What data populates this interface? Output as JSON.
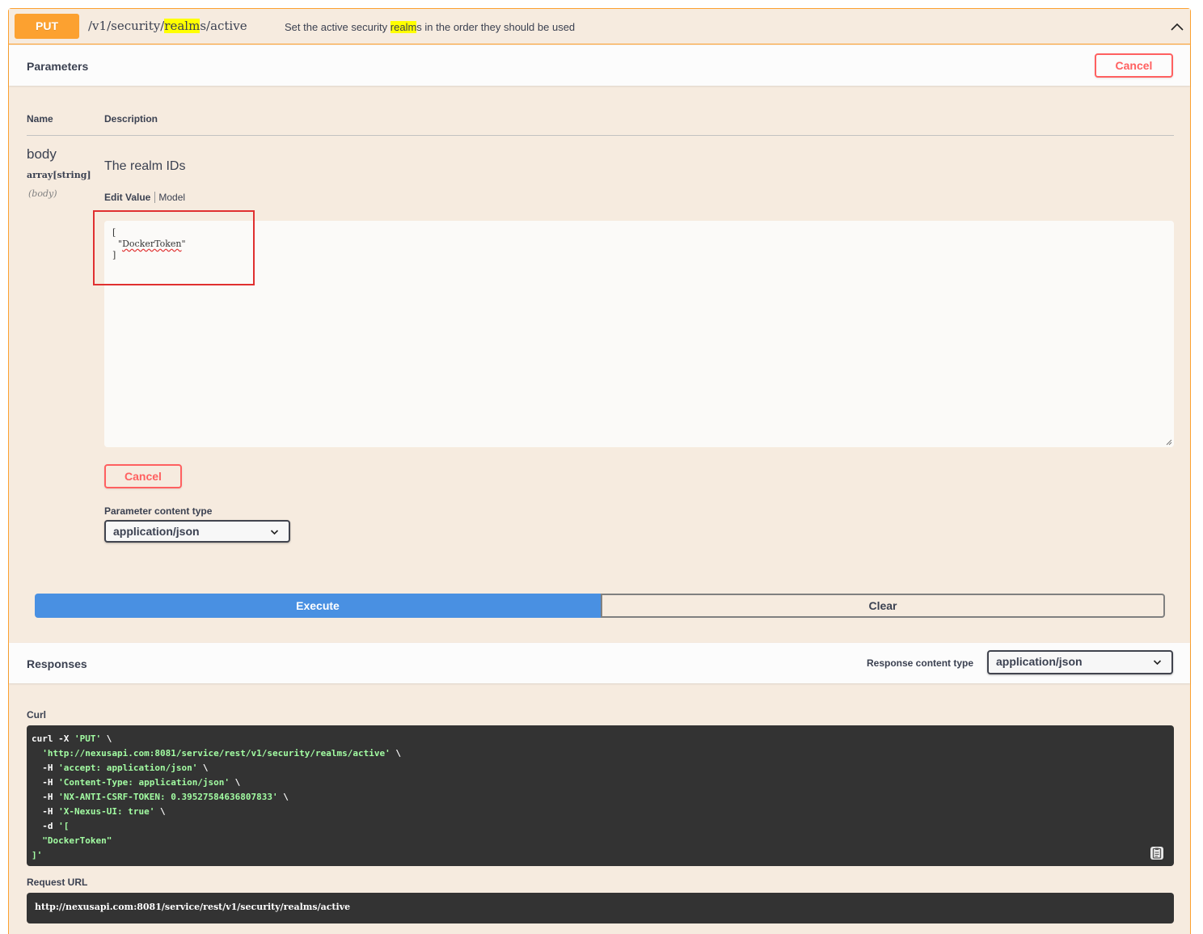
{
  "summary": {
    "method": "PUT",
    "path_prefix": "/v1/security/",
    "path_highlight": "realm",
    "path_suffix": "s/active",
    "desc_prefix": "Set the active security ",
    "desc_highlight": "realm",
    "desc_suffix": "s in the order they should be used"
  },
  "parameters": {
    "title": "Parameters",
    "cancel_label": "Cancel",
    "col_name": "Name",
    "col_description": "Description",
    "param": {
      "name": "body",
      "type": "array[string]",
      "in": "(body)",
      "description": "The realm IDs"
    },
    "tabs": {
      "edit_value": "Edit Value",
      "model": "Model"
    },
    "editor": {
      "line1": "[",
      "line2_pre": "  \"",
      "line2_word": "DockerToken",
      "line2_post": "\"",
      "line3": "]"
    },
    "cancel_bottom_label": "Cancel",
    "content_type_label": "Parameter content type",
    "content_type_value": "application/json"
  },
  "actions": {
    "execute": "Execute",
    "clear": "Clear"
  },
  "responses": {
    "title": "Responses",
    "content_type_label": "Response content type",
    "content_type_value": "application/json"
  },
  "curl": {
    "label": "Curl",
    "lines": [
      {
        "pre": "curl -X ",
        "str": "'PUT'",
        "post": " \\"
      },
      {
        "pre": "  ",
        "str": "'http://nexusapi.com:8081/service/rest/v1/security/realms/active'",
        "post": " \\"
      },
      {
        "pre": "  -H ",
        "str": "'accept: application/json'",
        "post": " \\"
      },
      {
        "pre": "  -H ",
        "str": "'Content-Type: application/json'",
        "post": " \\"
      },
      {
        "pre": "  -H ",
        "str": "'NX-ANTI-CSRF-TOKEN: 0.39527584636807833'",
        "post": " \\"
      },
      {
        "pre": "  -H ",
        "str": "'X-Nexus-UI: true'",
        "post": " \\"
      },
      {
        "pre": "  -d ",
        "str": "'[",
        "post": ""
      },
      {
        "pre": "",
        "str": "  \"DockerToken\"",
        "post": ""
      },
      {
        "pre": "",
        "str": "]'",
        "post": ""
      }
    ]
  },
  "request_url": {
    "label": "Request URL",
    "value": "http://nexusapi.com:8081/service/rest/v1/security/realms/active"
  },
  "colors": {
    "put_accent": "#fca130",
    "execute": "#4990e2",
    "cancel": "#ff6060",
    "code_bg": "#333333"
  },
  "icons": [
    "chevron-up-icon",
    "chevron-down-icon",
    "copy-to-clipboard-icon",
    "resize-grip-icon"
  ]
}
